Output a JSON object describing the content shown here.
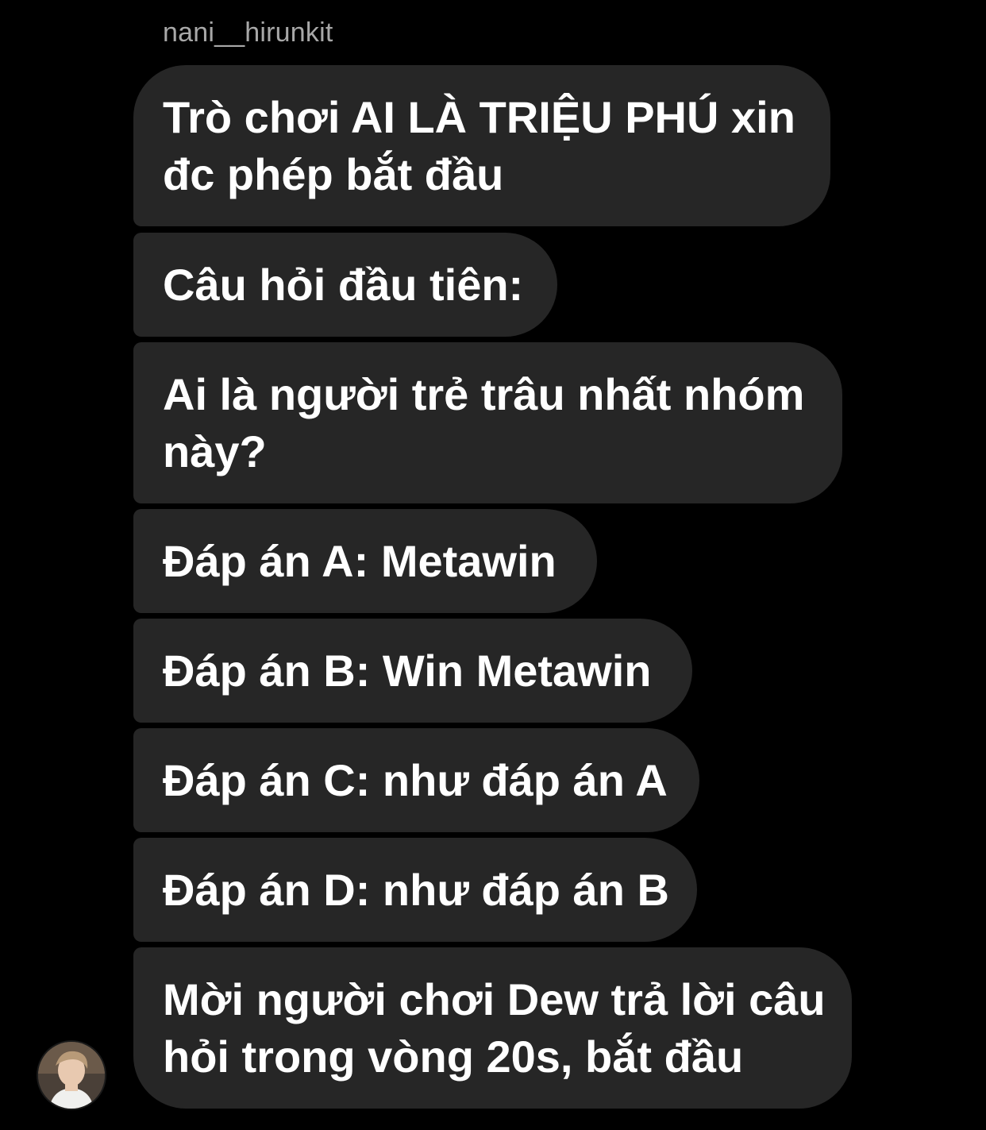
{
  "chat": {
    "sender_name": "nani__hirunkit",
    "messages": [
      {
        "line1": "Trò chơi AI LÀ TRIỆU PHÚ xin",
        "line2": "đc phép bắt đầu"
      },
      {
        "line1": "Câu hỏi đầu tiên:"
      },
      {
        "line1": "Ai là người trẻ trâu nhất nhóm",
        "line2": "này?"
      },
      {
        "line1": "Đáp án A: Metawin"
      },
      {
        "line1": "Đáp án B: Win Metawin"
      },
      {
        "line1": "Đáp án C: như đáp án A"
      },
      {
        "line1": "Đáp án D: như đáp án B"
      },
      {
        "line1": "Mời người chơi Dew trả lời câu",
        "line2": "hỏi trong vòng 20s, bắt đầu"
      }
    ]
  },
  "colors": {
    "background": "#000000",
    "bubble": "#262626",
    "sender_name": "#a8a8a8",
    "text": "#ffffff"
  },
  "icons": {
    "avatar": "profile-photo"
  }
}
